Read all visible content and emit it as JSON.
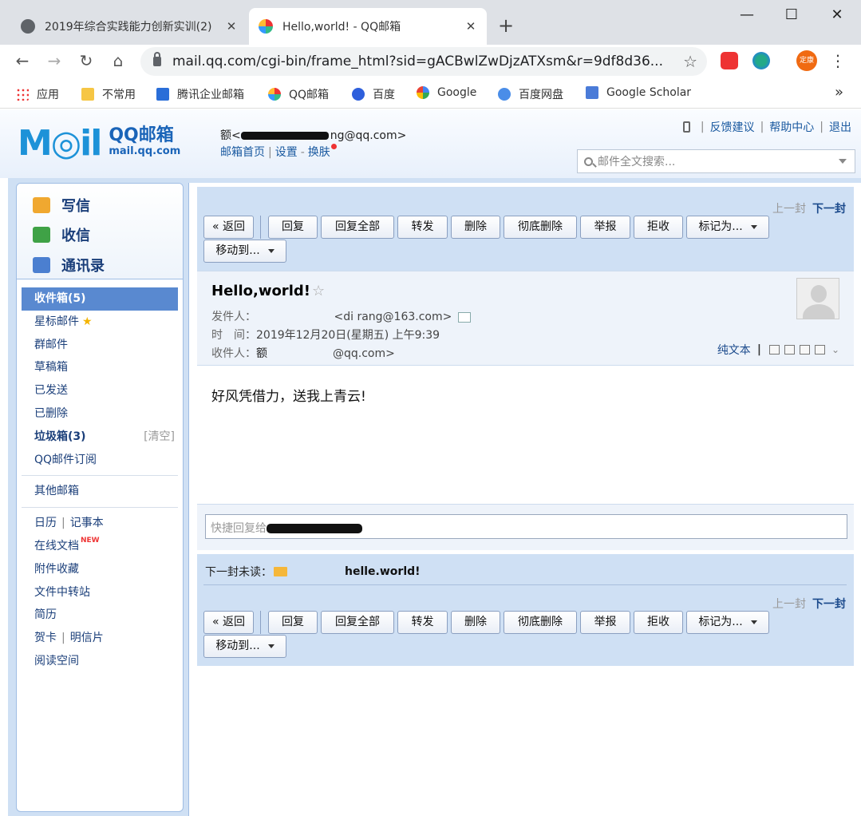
{
  "browser": {
    "tabs": [
      {
        "title": "2019年综合实践能力创新实训(2)",
        "active": false
      },
      {
        "title": "Hello,world! - QQ邮箱",
        "active": true
      }
    ],
    "new_tab": "+",
    "window": {
      "minimize": "—",
      "maximize": "☐",
      "close": "✕"
    },
    "url": "mail.qq.com/cgi-bin/frame_html?sid=gACBwlZwDjzATXsm&r=9df8d36...",
    "profile": "定康",
    "bookmarks": [
      "应用",
      "不常用",
      "腾讯企业邮箱",
      "QQ邮箱",
      "百度",
      "Google",
      "百度网盘",
      "Google Scholar"
    ],
    "more": "»"
  },
  "header": {
    "logo_text": "M◎il",
    "brand_cn": "QQ邮箱",
    "brand_url": "mail.qq.com",
    "account_prefix": "额<",
    "account_suffix": "ng@qq.com>",
    "links": [
      "邮箱首页",
      "设置",
      "换肤"
    ],
    "top_links": [
      "反馈建议",
      "帮助中心",
      "退出"
    ],
    "search_placeholder": "邮件全文搜索..."
  },
  "sidebar": {
    "quick": [
      "写信",
      "收信",
      "通讯录"
    ],
    "folders": {
      "inbox": "收件箱(5)",
      "starred": "星标邮件",
      "group": "群邮件",
      "drafts": "草稿箱",
      "sent": "已发送",
      "deleted": "已删除",
      "spam": "垃圾箱(3)",
      "spam_clear": "[清空]",
      "subscribe": "QQ邮件订阅",
      "other": "其他邮箱",
      "calendar": "日历",
      "notes": "记事本",
      "docs": "在线文档",
      "docs_badge": "NEW",
      "attachments": "附件收藏",
      "transfer": "文件中转站",
      "resume": "简历",
      "card": "贺卡",
      "postcard": "明信片",
      "reading": "阅读空间"
    }
  },
  "toolbar": {
    "prev": "上一封",
    "next": "下一封",
    "back": "« 返回",
    "reply": "回复",
    "reply_all": "回复全部",
    "forward": "转发",
    "delete": "删除",
    "delete_perm": "彻底删除",
    "report": "举报",
    "reject": "拒收",
    "mark_as": "标记为...",
    "move_to": "移动到..."
  },
  "mail": {
    "subject": "Hello,world!",
    "from_label": "发件人：",
    "from_email": "<di   rang@163.com>",
    "time_label": "时　间：",
    "time_value": "2019年12月20日(星期五) 上午9:39",
    "to_label": "收件人：",
    "to_name": "额",
    "to_email": "@qq.com>",
    "plain_text": "纯文本",
    "body": "好风凭借力，送我上青云!",
    "quick_reply_placeholder": "快捷回复给",
    "next_unread_label": "下一封未读：",
    "next_unread_subject": "helle.world!"
  }
}
